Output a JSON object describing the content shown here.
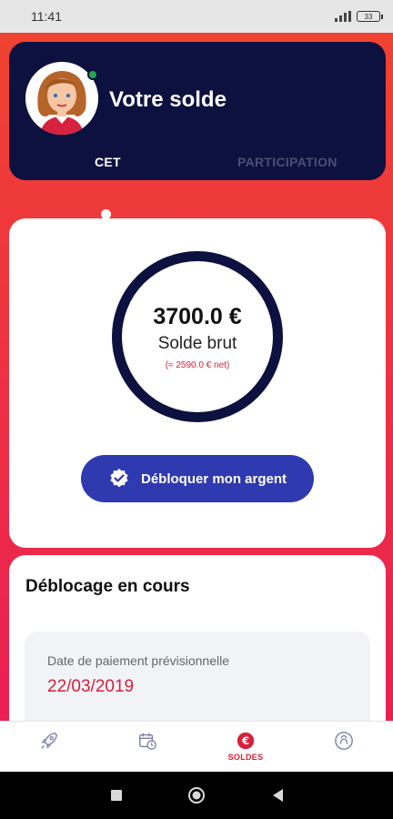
{
  "status_bar": {
    "time": "11:41",
    "battery": "33"
  },
  "header": {
    "title": "Votre solde",
    "tabs": [
      {
        "label": "CET",
        "active": true
      },
      {
        "label": "PARTICIPATION",
        "active": false
      }
    ]
  },
  "balance": {
    "amount": "3700.0 €",
    "label": "Solde brut",
    "net": "(≈ 2590.0 € net)",
    "unlock_button": "Débloquer mon argent"
  },
  "progress": {
    "title": "Déblocage en cours",
    "date_label": "Date de paiement prévisionnelle",
    "date_value": "22/03/2019"
  },
  "bottom_nav": {
    "items": [
      {
        "icon": "rocket-icon",
        "label": ""
      },
      {
        "icon": "calendar-clock-icon",
        "label": ""
      },
      {
        "icon": "euro-icon",
        "label": "SOLDES",
        "active": true
      },
      {
        "icon": "profile-icon",
        "label": ""
      }
    ]
  },
  "colors": {
    "brand_navy": "#0d1140",
    "accent_red": "#ee2f45",
    "button_blue": "#2f3ab0",
    "highlight_red": "#d81f3b"
  }
}
